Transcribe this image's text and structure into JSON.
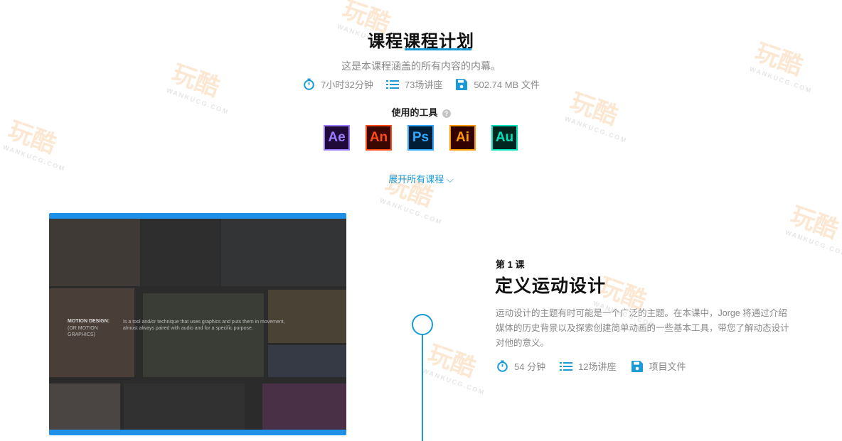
{
  "header": {
    "title": "课程课程计划",
    "subtitle": "这是本课程涵盖的所有内容的内幕。",
    "stats": {
      "duration": "7小时32分钟",
      "lectures": "73场讲座",
      "files": "502.74 MB 文件"
    },
    "tools_label": "使用的工具",
    "help_glyph": "?",
    "tools": [
      {
        "abbr": "Ae",
        "color": "#9a7cff",
        "bg": "#1f0a3a"
      },
      {
        "abbr": "An",
        "color": "#ff4a1a",
        "bg": "#3a0800"
      },
      {
        "abbr": "Ps",
        "color": "#31a8ff",
        "bg": "#001e36"
      },
      {
        "abbr": "Ai",
        "color": "#ff9a00",
        "bg": "#330000"
      },
      {
        "abbr": "Au",
        "color": "#00e4bb",
        "bg": "#00261f"
      }
    ],
    "expand_label": "展开所有课程 ⌵"
  },
  "lesson": {
    "number_label": "第 1 课",
    "title": "定义运动设计",
    "description": "运动设计的主题有时可能是一个广泛的主题。在本课中，Jorge 将通过介绍媒体的历史背景以及探索创建简单动画的一些基本工具，带您了解动态设计对他的意义。",
    "stats": {
      "duration": "54 分钟",
      "lectures": "12场讲座",
      "files": "项目文件"
    },
    "thumbnail": {
      "heading": "MOTION DESIGN:",
      "subheading": "(OR MOTION GRAPHICS)",
      "body": "Is a tool and/or technique that uses graphics and puts them in movement, almost always paired with audio and for a specific purpose."
    }
  },
  "watermark": {
    "logo_text": "玩酷",
    "site": "WANKUCG.COM"
  },
  "colors": {
    "accent": "#1a9bd7",
    "thumb_bar": "#1e90e8"
  }
}
